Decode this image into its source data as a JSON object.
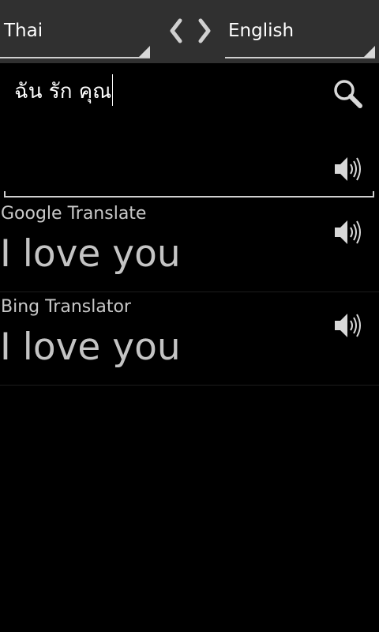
{
  "language_bar": {
    "source_language": "Thai",
    "target_language": "English",
    "prev_icon": "chevron-left-icon",
    "next_icon": "chevron-right-icon"
  },
  "input": {
    "text": "ฉัน รัก คุณ",
    "search_icon": "search-icon",
    "speaker_icon": "speaker-icon"
  },
  "results": [
    {
      "provider": "Google Translate",
      "translation": "I love you",
      "speaker_icon": "speaker-icon"
    },
    {
      "provider": "Bing Translator",
      "translation": "I love you",
      "speaker_icon": "speaker-icon"
    }
  ],
  "colors": {
    "background": "#000000",
    "bar": "#303030",
    "text_primary": "#ffffff",
    "text_secondary": "#c4c4c4"
  }
}
